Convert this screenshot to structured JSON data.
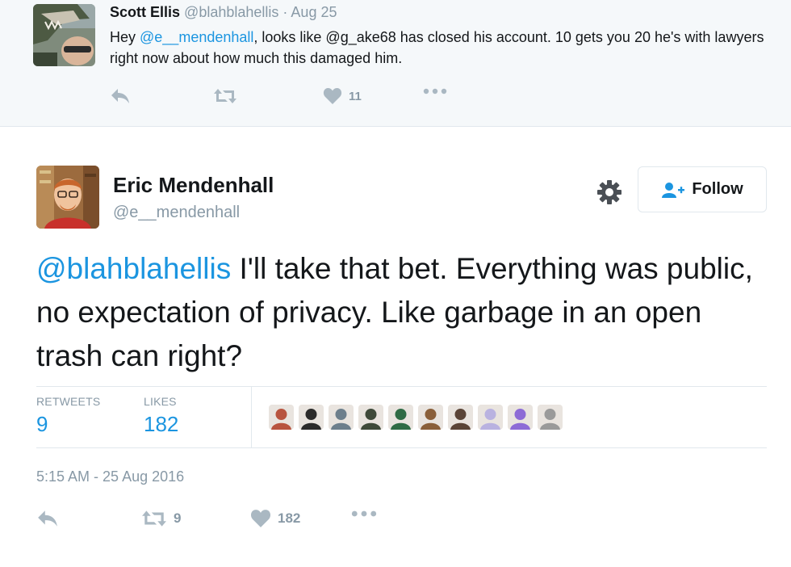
{
  "reply": {
    "name": "Scott Ellis",
    "handle": "@blahblahellis",
    "separator": "·",
    "date": "Aug 25",
    "text": {
      "part1": "Hey ",
      "mention1": "@e__mendenhall",
      "part2": ", looks like @g_ake68 has closed his account. 10 gets you 20 he's with lawyers right now about how much this damaged him."
    },
    "actions": {
      "reply_icon": "reply-icon",
      "retweet_icon": "retweet-icon",
      "like_icon": "heart-icon",
      "like_count": "11",
      "more_icon": "more-icon"
    }
  },
  "tweet": {
    "name": "Eric Mendenhall",
    "handle": "@e__mendenhall",
    "follow_label": "Follow",
    "text": {
      "mention": "@blahblahellis",
      "body": " I'll take that bet. Everything was public, no expectation of privacy. Like garbage in an open trash can right?"
    },
    "stats": {
      "retweets_label": "RETWEETS",
      "retweets_count": "9",
      "likes_label": "LIKES",
      "likes_count": "182"
    },
    "likers": [
      {
        "color": "#b8543f"
      },
      {
        "color": "#2b2b2b"
      },
      {
        "color": "#6d7f8c"
      },
      {
        "color": "#3f4a3a"
      },
      {
        "color": "#2f6b45"
      },
      {
        "color": "#8a5f3a"
      },
      {
        "color": "#5a4437"
      },
      {
        "color": "#b9b2e0"
      },
      {
        "color": "#8d6bd6"
      },
      {
        "color": "#9a9a9a"
      }
    ],
    "timestamp": "5:15 AM - 25 Aug 2016",
    "actions": {
      "retweet_count": "9",
      "like_count": "182"
    }
  },
  "colors": {
    "link": "#1b95e0",
    "muted": "#8899a6",
    "icon": "#aab8c2"
  }
}
